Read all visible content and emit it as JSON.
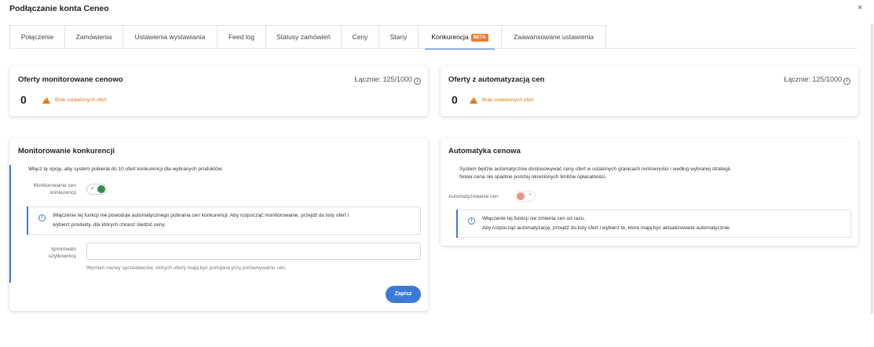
{
  "modal": {
    "title": "Podłączanie konta Ceneo",
    "close": "×"
  },
  "tabs": [
    {
      "label": "Połączenie"
    },
    {
      "label": "Zamówienia"
    },
    {
      "label": "Ustawienia wystawiania"
    },
    {
      "label": "Feed log"
    },
    {
      "label": "Statusy zamówień"
    },
    {
      "label": "Ceny"
    },
    {
      "label": "Stany"
    },
    {
      "label": "Konkurencja",
      "badge": "BETA"
    },
    {
      "label": "Zaawansowane ustawienia"
    }
  ],
  "monitored": {
    "title": "Oferty monitorowane cenowo",
    "total": "Łącznie: 125/1000",
    "count": "0",
    "warning": "Brak ustawionych ofert"
  },
  "automated": {
    "title": "Oferty z automatyzacją cen",
    "total": "Łącznie: 125/1000",
    "count": "0",
    "warning": "Brak ustawionych ofert"
  },
  "competition": {
    "title": "Monitorowanie konkurencji",
    "description": "Włącz tę opcję, aby system pobierał do 10 ofert konkurencji dla wybranych produktów.",
    "toggle_label_1": "Monitorowanie cen",
    "toggle_label_2": "konkurencji",
    "toggle_on": true,
    "info_line_1": "Włączenie tej funkcji nie powoduje automatycznego pobrania cen konkurencji. Aby rozpocząć monitorowanie, przejdź do listy ofert i",
    "info_line_2": "wybierz produkty, dla których chcesz śledzić ceny.",
    "ignored_label_1": "Ignorowani",
    "ignored_label_2": "użytkownicy",
    "ignored_value": "",
    "ignored_hint": "Wymień nazwy sprzedawców, których oferty mają być pomijane przy porównywaniu cen.",
    "save_label": "Zapisz"
  },
  "pricing": {
    "title": "Automatyka cenowa",
    "description_1": "System będzie automatycznie dostosowywać ceny ofert w ustalonych granicach rentowności i według wybranej strategii.",
    "description_2": "Nowa cena nie spadnie poniżej określonych limitów opłacalności.",
    "toggle_label": "Automatyzowanie cen",
    "toggle_on": false,
    "info_line_1": "Włączenie tej funkcji nie zmienia cen od razu.",
    "info_line_2": "Aby rozpocząć automatyzację, przejdź do listy ofert i wybierz te, które mają być aktualizowane automatycznie."
  },
  "colors": {
    "accent": "#3b7ad9",
    "warning": "#e8740e",
    "toggle_on": "#2e8b57",
    "toggle_off": "#e8948f",
    "beta": "#f07a2a"
  }
}
